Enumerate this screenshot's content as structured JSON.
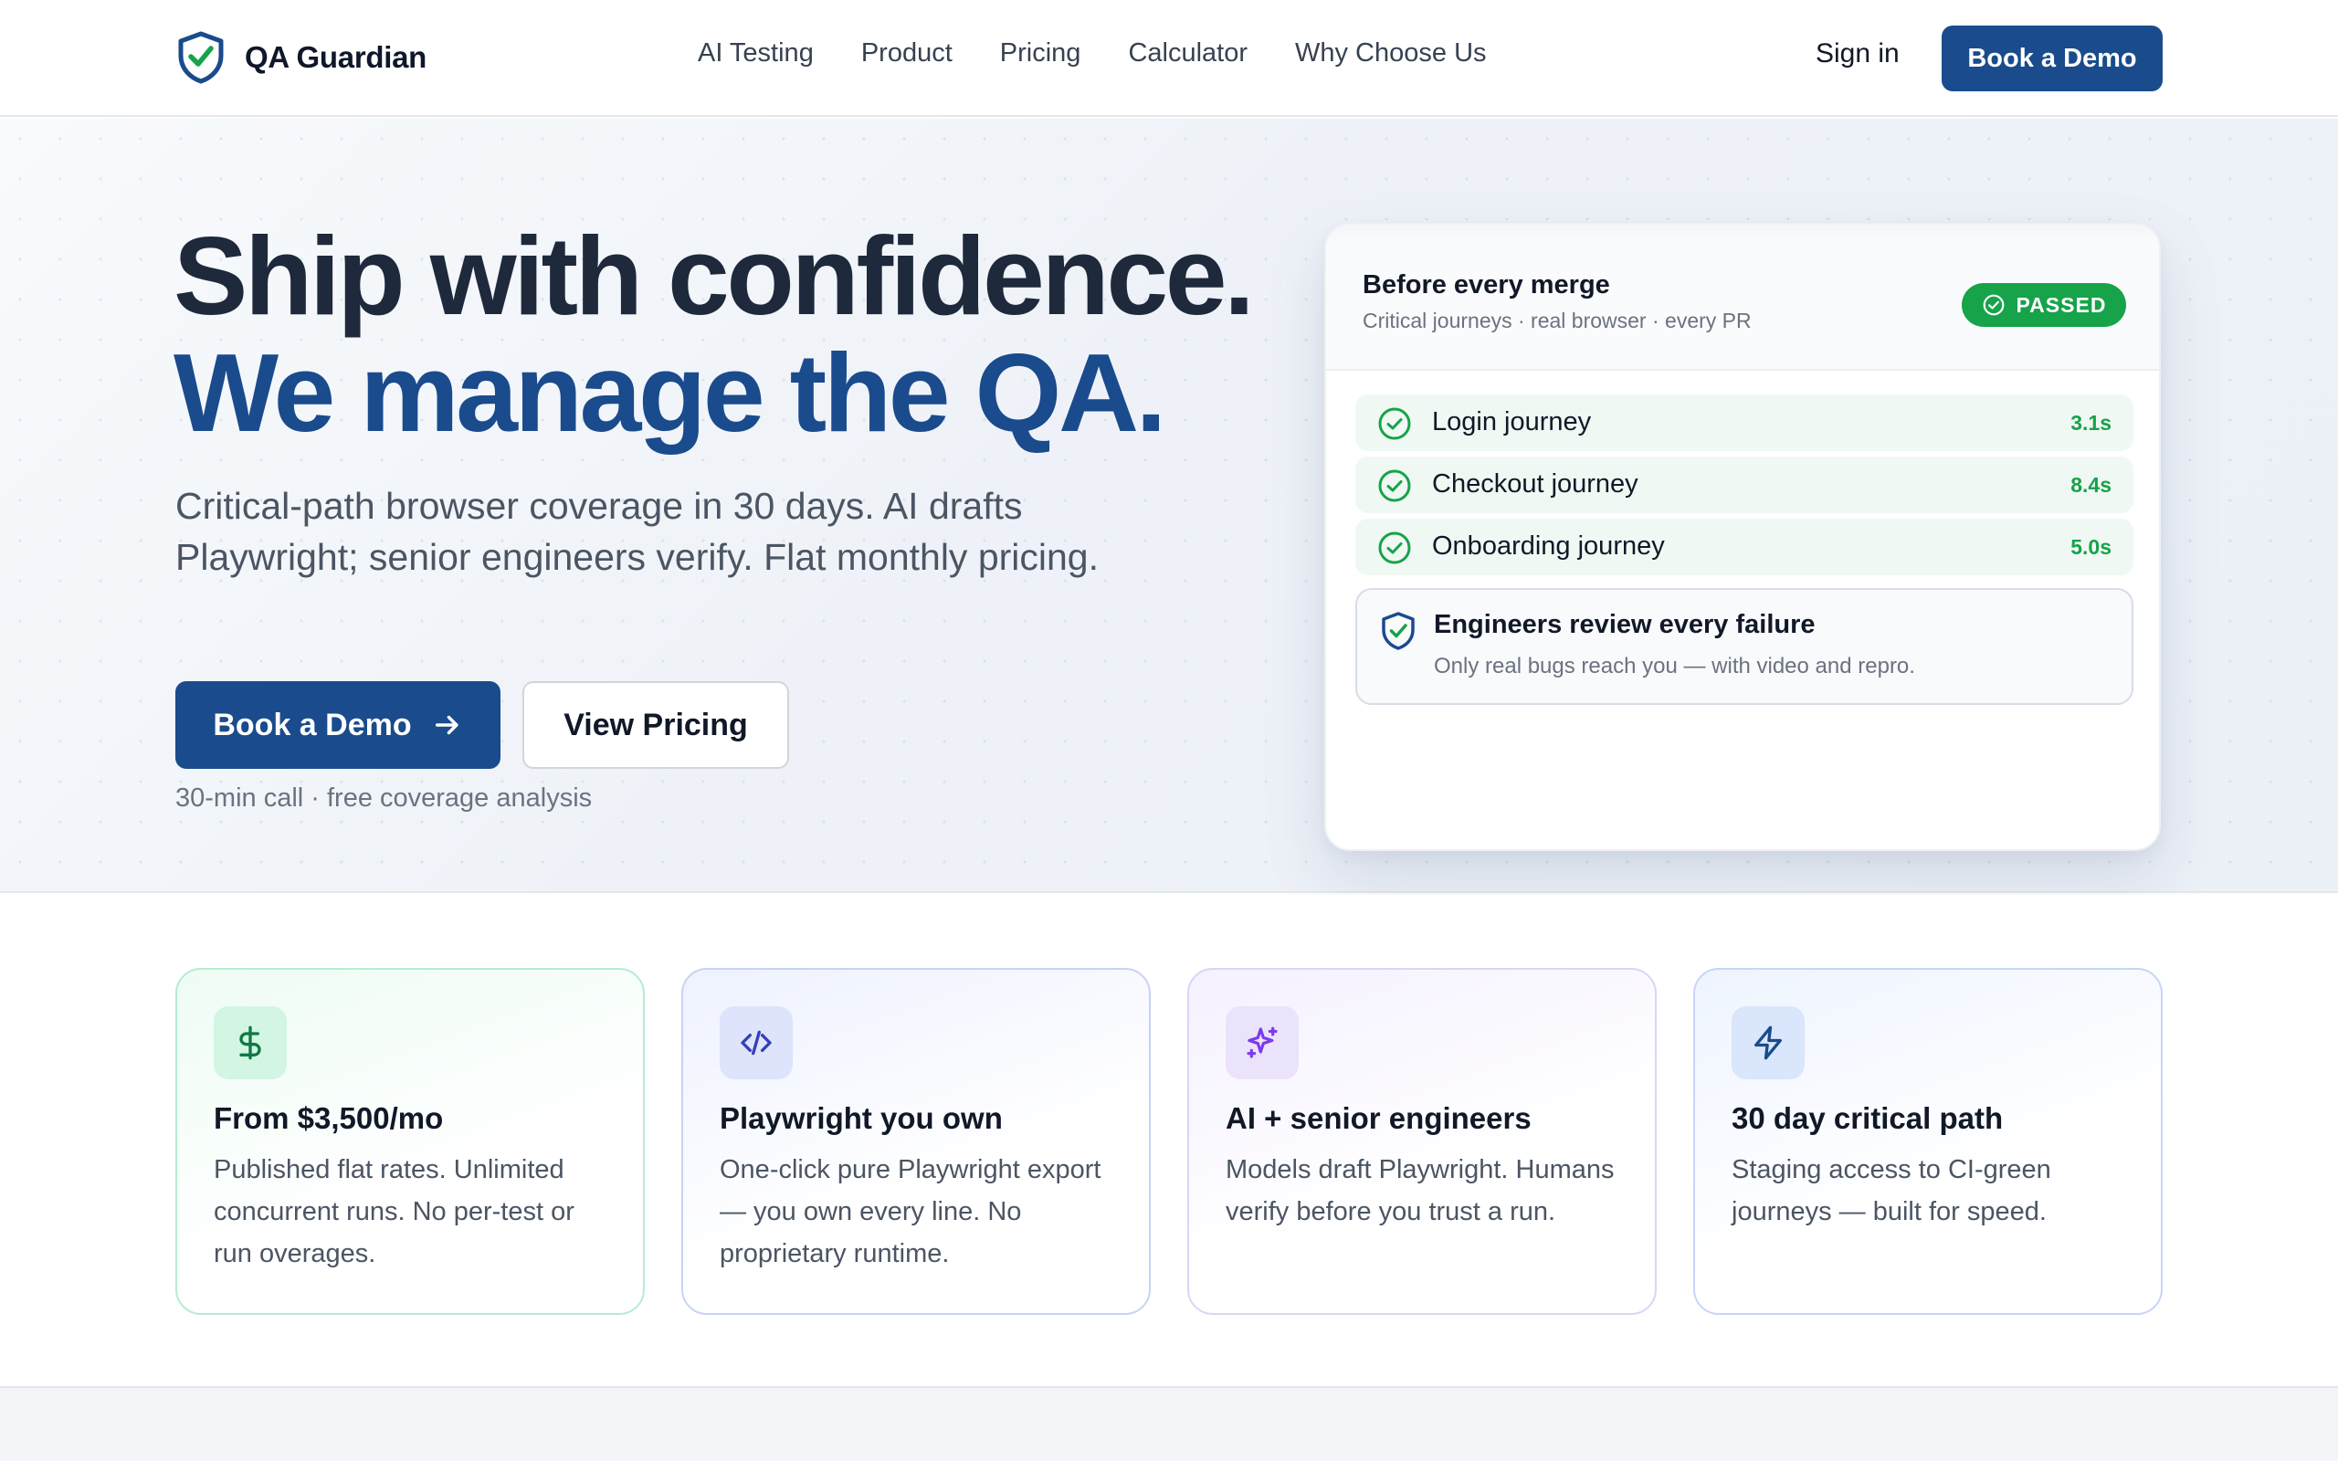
{
  "nav": {
    "brand": "QA Guardian",
    "links": [
      "AI Testing",
      "Product",
      "Pricing",
      "Calculator",
      "Why Choose Us"
    ],
    "sign_in": "Sign in",
    "cta": "Book a Demo"
  },
  "hero": {
    "headline_line1": "Ship with confidence.",
    "headline_line2": "We manage the QA.",
    "subtext": "Critical-path browser coverage in 30 days. AI drafts Playwright; senior engineers verify. Flat monthly pricing.",
    "primary_cta": "Book a Demo",
    "secondary_cta": "View Pricing",
    "cta_note": "30-min call · free coverage analysis"
  },
  "status_card": {
    "title": "Before every merge",
    "subtitle": "Critical journeys · real browser · every PR",
    "badge": "PASSED",
    "journeys": [
      {
        "name": "Login journey",
        "time": "3.1s"
      },
      {
        "name": "Checkout journey",
        "time": "8.4s"
      },
      {
        "name": "Onboarding journey",
        "time": "5.0s"
      }
    ],
    "review": {
      "title": "Engineers review every failure",
      "subtitle": "Only real bugs reach you — with video and repro."
    }
  },
  "features": [
    {
      "icon": "dollar-icon",
      "title": "From $3,500/mo",
      "text": "Published flat rates. Unlimited concurrent runs. No per-test or run overages."
    },
    {
      "icon": "code-icon",
      "title": "Playwright you own",
      "text": "One-click pure Playwright export — you own every line. No proprietary runtime."
    },
    {
      "icon": "sparkles-icon",
      "title": "AI + senior engineers",
      "text": "Models draft Playwright. Humans verify before you trust a run."
    },
    {
      "icon": "lightning-icon",
      "title": "30 day critical path",
      "text": "Staging access to CI-green journeys — built for speed."
    }
  ],
  "colors": {
    "brand_navy": "#1a4b8c",
    "success_green": "#16a34a",
    "headline_dark": "#1e293b"
  }
}
